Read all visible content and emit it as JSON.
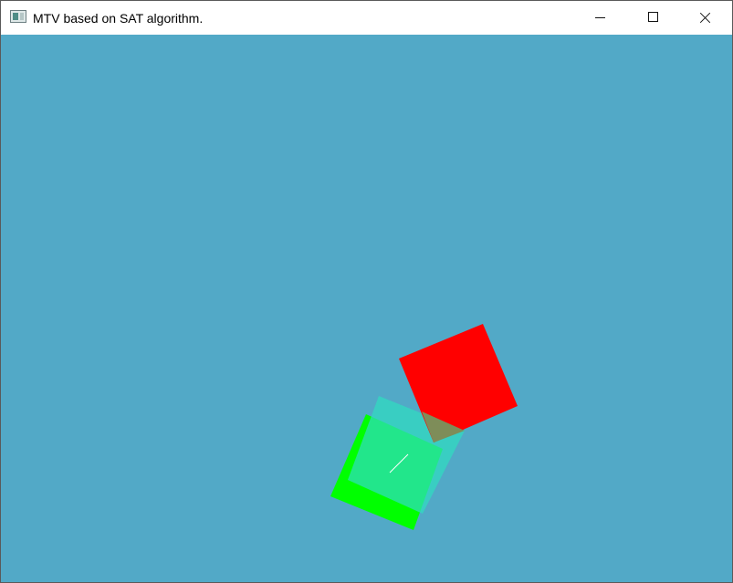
{
  "window": {
    "title": "MTV based on SAT algorithm."
  },
  "titlebar_icons": {
    "app": "application-icon",
    "minimize": "minimize-icon",
    "maximize": "maximize-icon",
    "close": "close-icon"
  },
  "scene": {
    "background_color": "#52a9c7",
    "shapes": {
      "red_square": {
        "color": "#ff0000"
      },
      "cyan_square": {
        "color": "#2fdcc0"
      },
      "green_square": {
        "color": "#00ff00"
      },
      "overlap_region": {
        "color": "#7e8d59"
      },
      "mtv_vector": {
        "color": "#ffffff"
      }
    }
  }
}
